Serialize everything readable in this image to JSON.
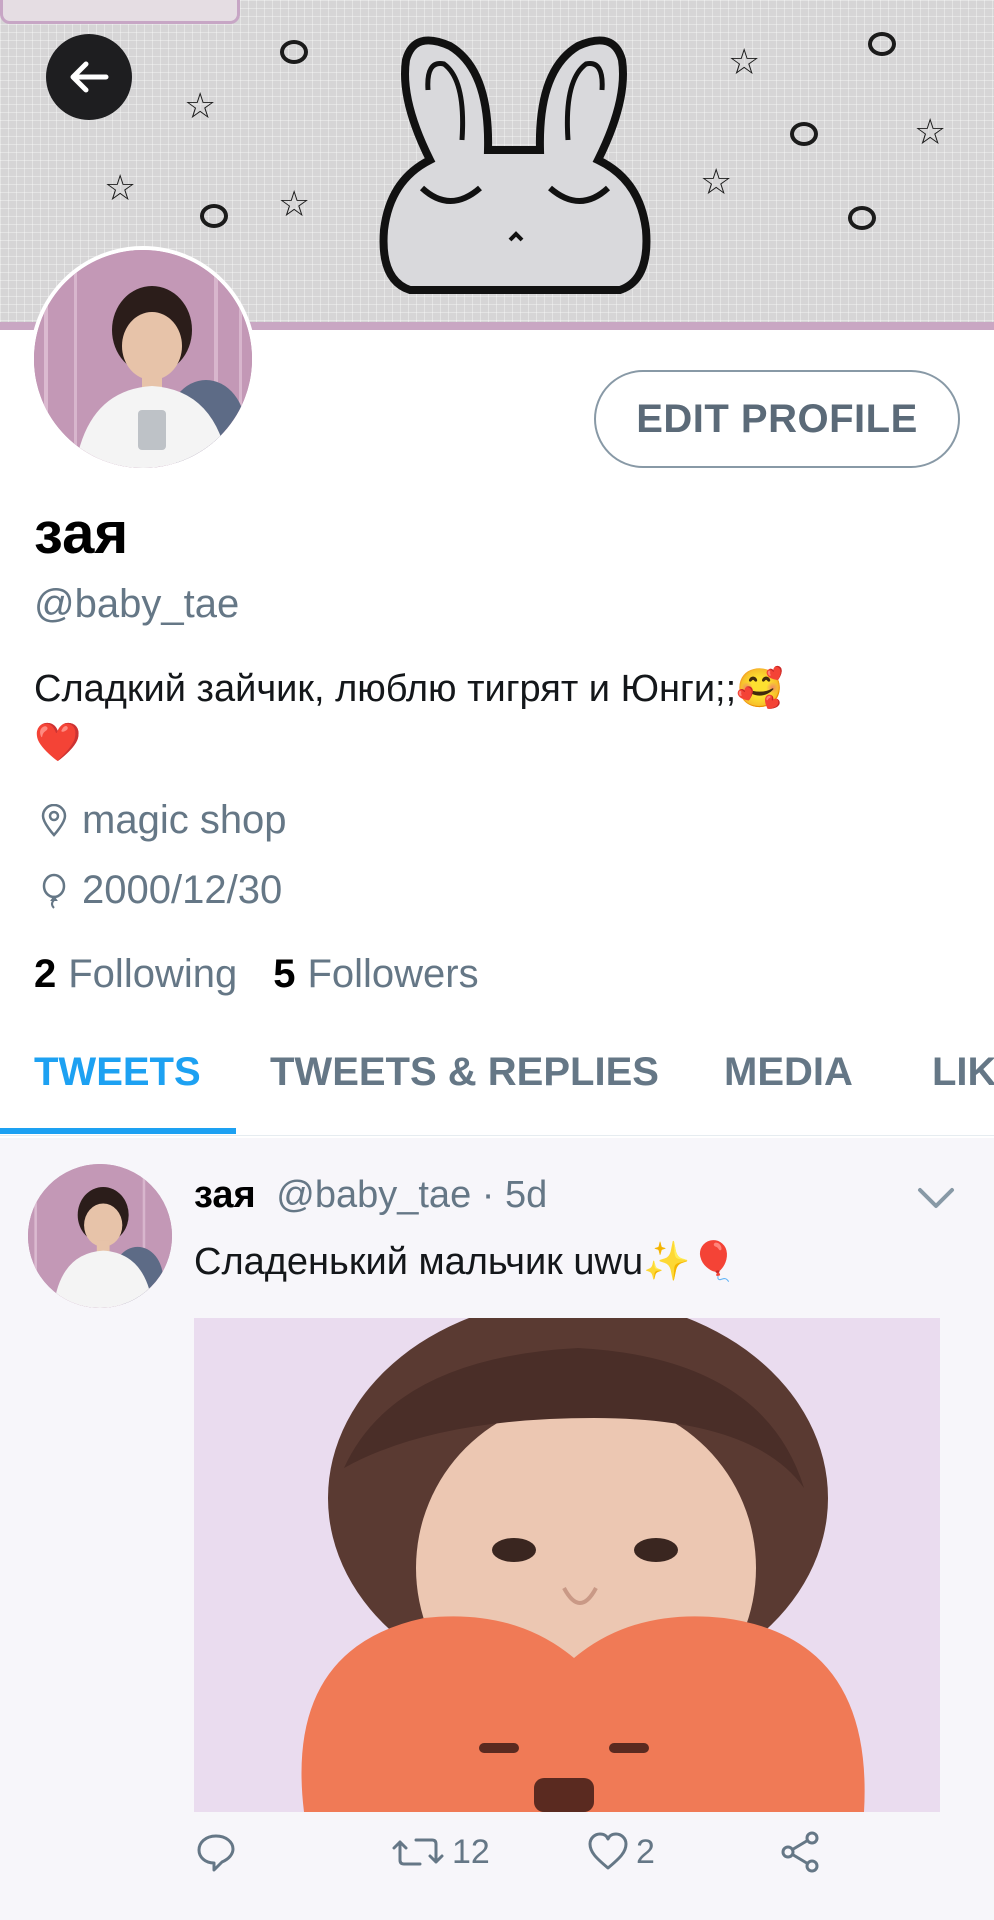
{
  "header": {
    "back_label": "Back"
  },
  "profile": {
    "display_name": "зая",
    "handle": "@baby_tae",
    "bio_line1": "Сладкий зайчик, люблю тигрят и Юнги;;🥰",
    "bio_line2": "❤️",
    "location": "magic shop",
    "birthdate": "2000/12/30",
    "following_count": "2",
    "following_label": "Following",
    "followers_count": "5",
    "followers_label": "Followers",
    "edit_label": "EDIT PROFILE"
  },
  "tabs": [
    {
      "label": "TWEETS",
      "active": true
    },
    {
      "label": "TWEETS & REPLIES",
      "active": false
    },
    {
      "label": "MEDIA",
      "active": false
    },
    {
      "label": "LIK",
      "active": false
    }
  ],
  "tweet": {
    "name": "зая",
    "handle": "@baby_tae",
    "separator": "·",
    "time": "5d",
    "text": "Сладенький мальчик uwu✨🎈",
    "retweets": "12",
    "likes": "2"
  },
  "icons": [
    "back-arrow-icon",
    "location-pin-icon",
    "balloon-icon",
    "chevron-down-icon",
    "reply-icon",
    "retweet-icon",
    "heart-icon",
    "share-icon"
  ],
  "colors": {
    "accent": "#1da1f2",
    "secondary_text": "#657786",
    "border": "#8899a6"
  }
}
